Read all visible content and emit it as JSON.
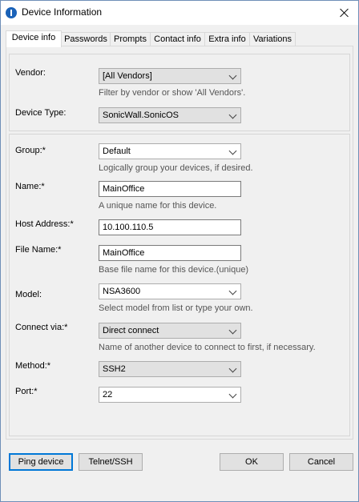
{
  "window": {
    "title": "Device Information"
  },
  "tabs": [
    "Device info",
    "Passwords",
    "Prompts",
    "Contact info",
    "Extra info",
    "Variations"
  ],
  "vendor": {
    "label": "Vendor:",
    "value": "[All Vendors]",
    "hint": "Filter by vendor or show 'All Vendors'."
  },
  "device_type": {
    "label": "Device Type:",
    "value": "SonicWall.SonicOS"
  },
  "group": {
    "label": "Group:*",
    "value": "Default",
    "hint": "Logically group your devices, if desired."
  },
  "name": {
    "label": "Name:*",
    "value": "MainOffice",
    "hint": "A unique name for this device."
  },
  "host": {
    "label": "Host Address:*",
    "value": "10.100.110.5"
  },
  "file_name": {
    "label": "File Name:*",
    "value": "MainOffice",
    "hint": "Base file name for this device.(unique)"
  },
  "model": {
    "label": "Model:",
    "value": "NSA3600",
    "hint": "Select model from list or type your own."
  },
  "connect_via": {
    "label": "Connect via:*",
    "value": "Direct connect",
    "hint": "Name of another device to connect to first, if necessary."
  },
  "method": {
    "label": "Method:*",
    "value": "SSH2"
  },
  "port": {
    "label": "Port:*",
    "value": "22"
  },
  "buttons": {
    "ping": "Ping device",
    "telnet": "Telnet/SSH",
    "ok": "OK",
    "cancel": "Cancel"
  }
}
